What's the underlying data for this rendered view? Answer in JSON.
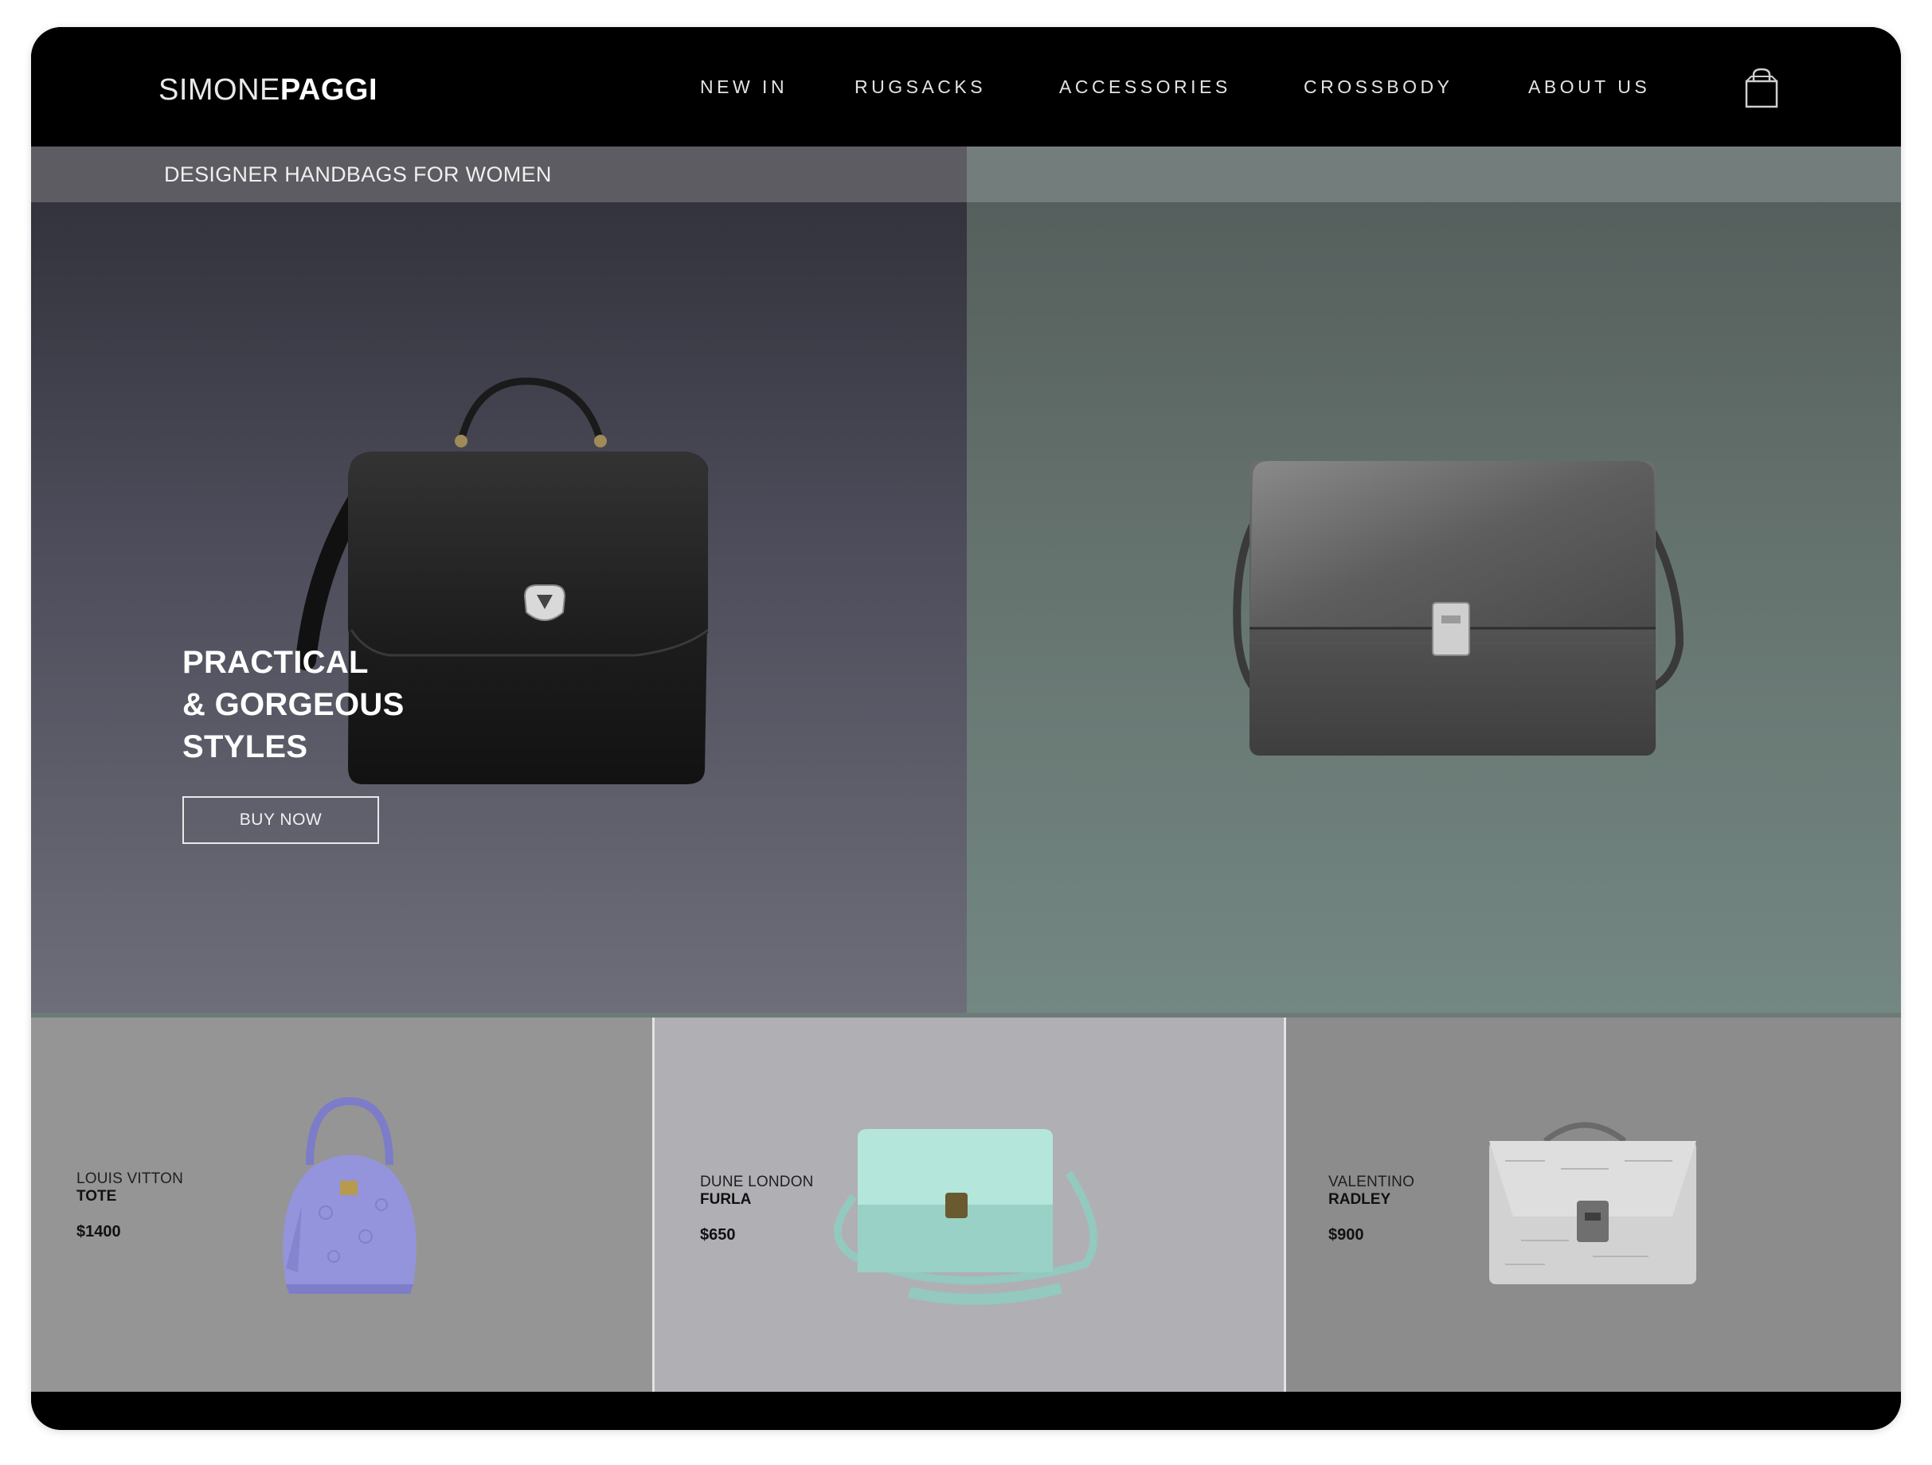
{
  "brand": {
    "logo_light": "SIMONE",
    "logo_bold": "PAGGI"
  },
  "nav": {
    "items": [
      {
        "label": "NEW IN"
      },
      {
        "label": "RUGSACKS"
      },
      {
        "label": "ACCESSORIES"
      },
      {
        "label": "CROSSBODY"
      },
      {
        "label": "ABOUT US"
      }
    ],
    "cart_icon": "shopping-bag-icon"
  },
  "hero": {
    "tagline": "DESIGNER HANDBAGS FOR WOMEN",
    "headline": [
      "PRACTICAL",
      "& GORGEOUS",
      "STYLES"
    ],
    "cta_label": "BUY NOW",
    "left_bag_color": "#1c1c1c",
    "right_bag_color": "#5a5a5a"
  },
  "products": [
    {
      "brand": "LOUIS VITTON",
      "model": "TOTE",
      "price": "$1400",
      "color": "#8f8fd6"
    },
    {
      "brand": "DUNE LONDON",
      "model": "FURLA",
      "price": "$650",
      "color": "#9ed2c8"
    },
    {
      "brand": "VALENTINO",
      "model": "RADLEY",
      "price": "$900",
      "color": "#cfcfcf"
    }
  ],
  "colors": {
    "header_bg": "#000000",
    "hero_left": "#4c4c5a",
    "hero_right": "#66746f"
  }
}
